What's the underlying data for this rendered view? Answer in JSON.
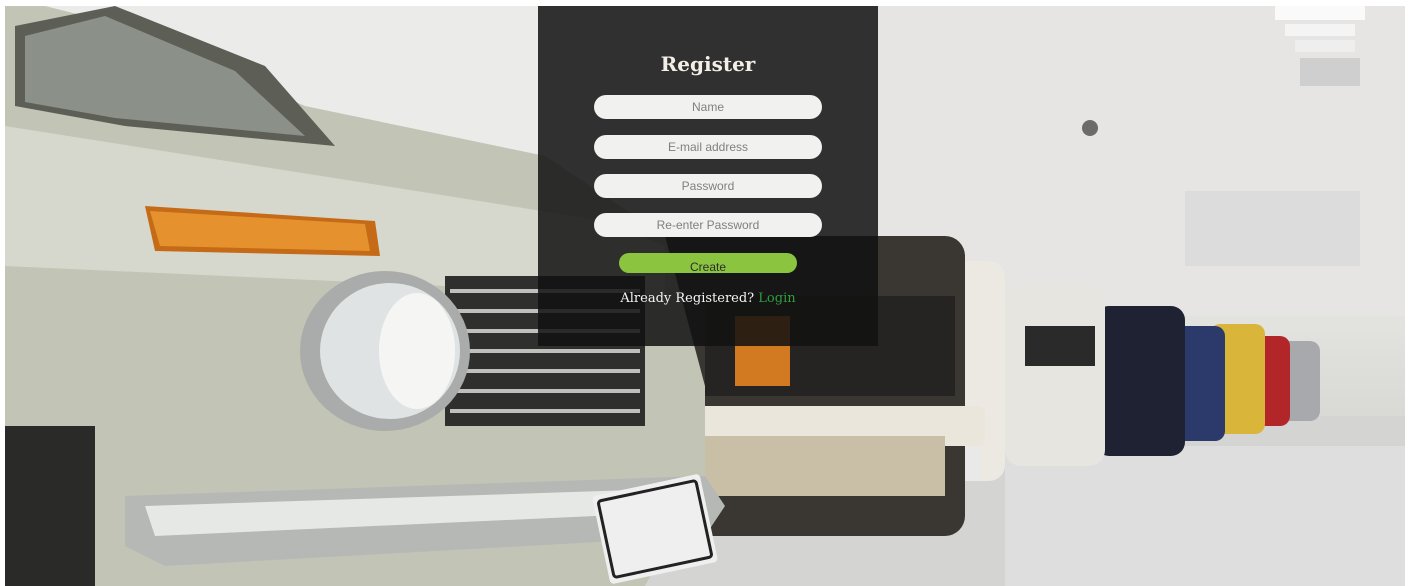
{
  "form": {
    "title": "Register",
    "name_placeholder": "Name",
    "email_placeholder": "E-mail address",
    "password_placeholder": "Password",
    "repassword_placeholder": "Re-enter Password",
    "create_label": "Create",
    "already_text": "Already Registered? ",
    "login_label": "Login"
  },
  "colors": {
    "accent": "#8bc53f",
    "link": "#2e9e3f",
    "panel": "#121212"
  }
}
